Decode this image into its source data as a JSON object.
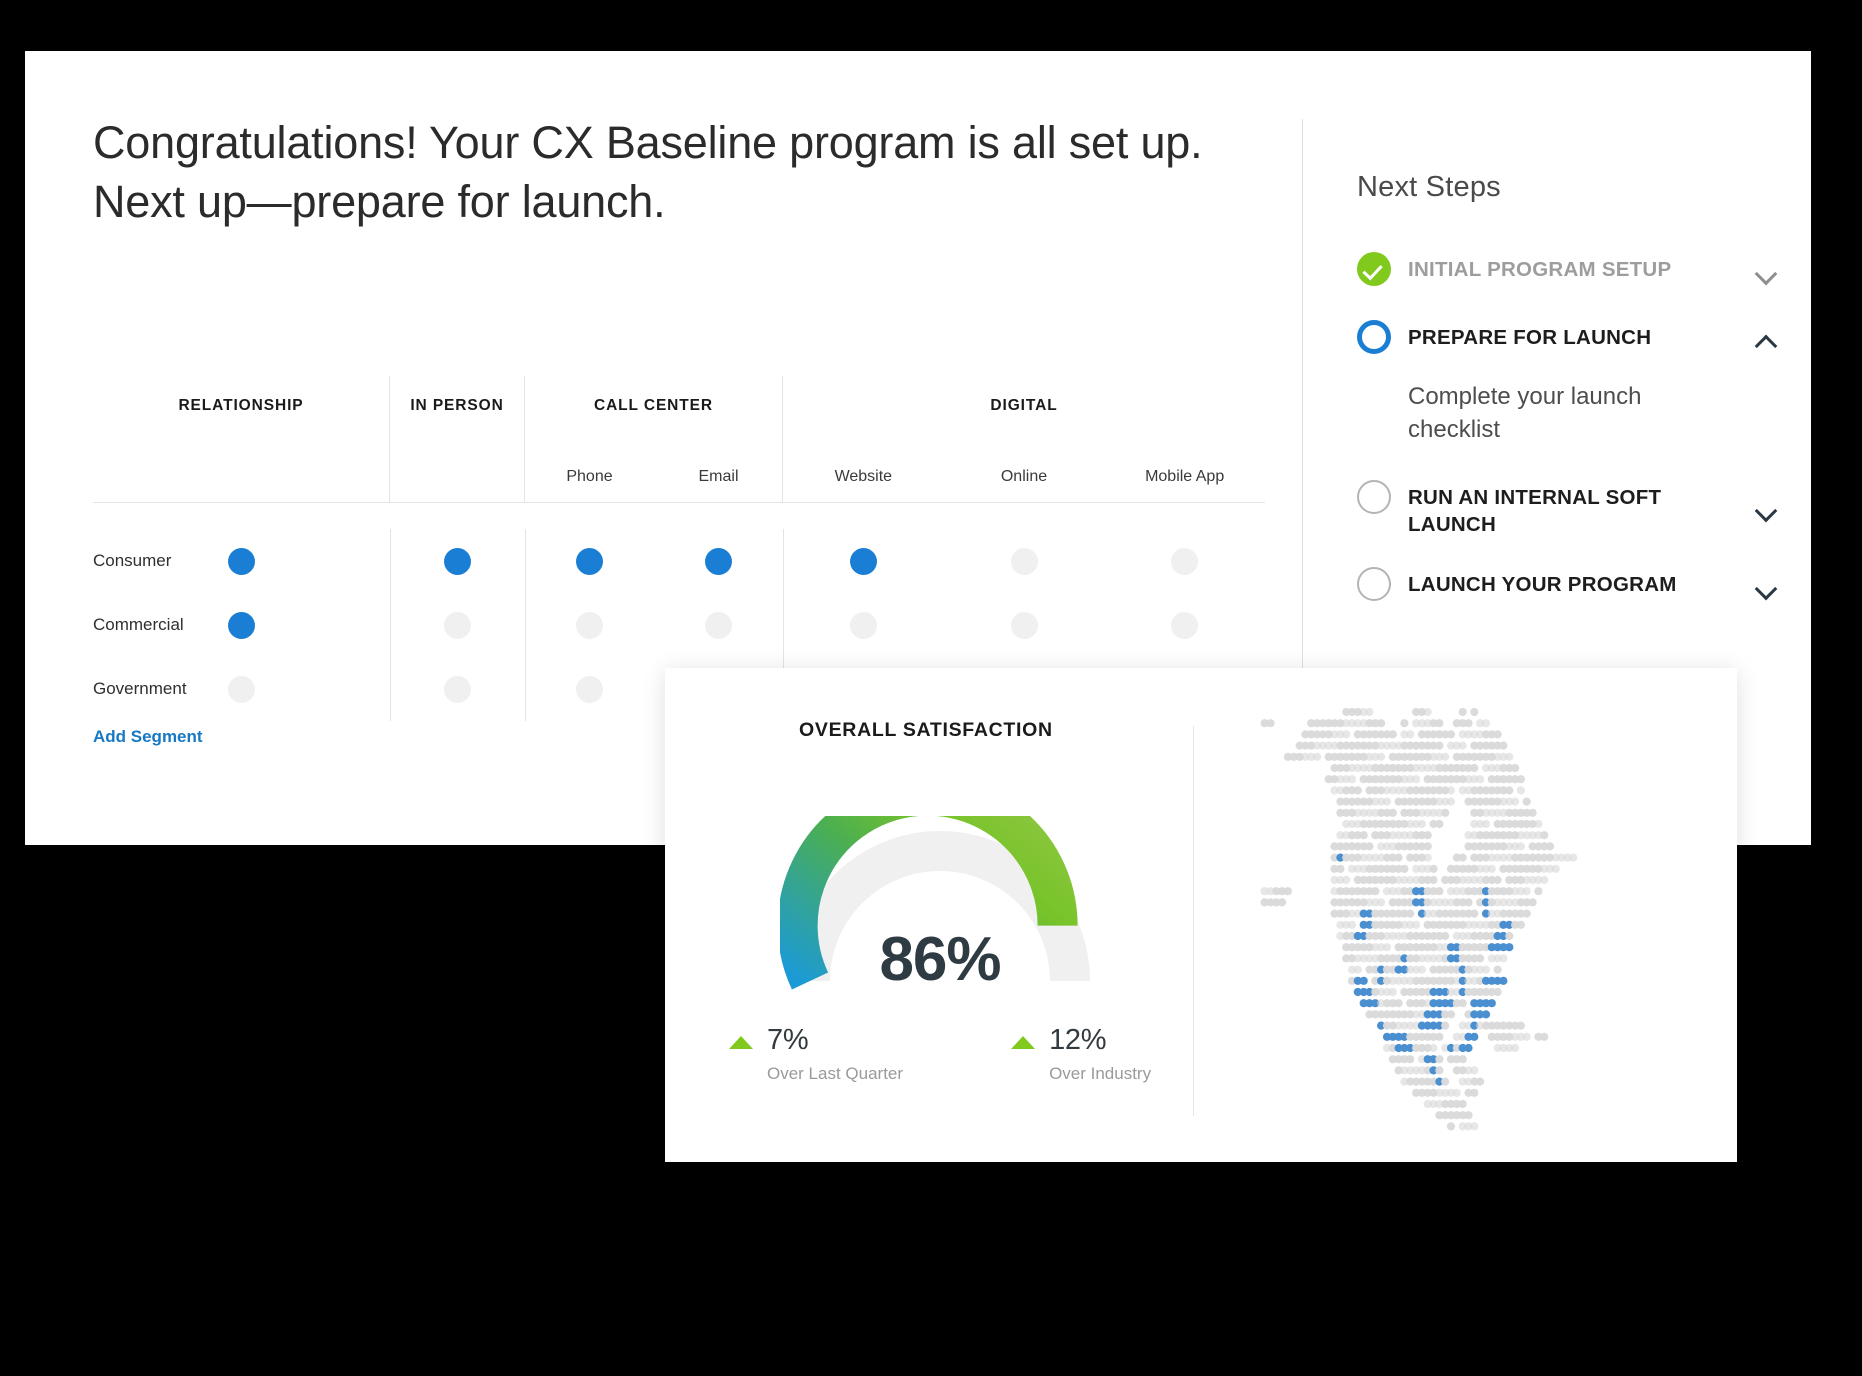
{
  "headline": "Congratulations! Your CX Baseline program is all set up. Next up—prepare for launch.",
  "matrix": {
    "groups": [
      {
        "label": "RELATIONSHIP",
        "subs": [
          ""
        ]
      },
      {
        "label": "IN PERSON",
        "subs": [
          ""
        ]
      },
      {
        "label": "CALL CENTER",
        "subs": [
          "Phone",
          "Email"
        ]
      },
      {
        "label": "DIGITAL",
        "subs": [
          "Website",
          "Online",
          "Mobile App"
        ]
      }
    ],
    "columns": [
      "Relationship",
      "In Person",
      "Phone",
      "Email",
      "Website",
      "Online",
      "Mobile App"
    ],
    "rows": [
      {
        "label": "Consumer",
        "cells": [
          true,
          true,
          true,
          true,
          true,
          false,
          false
        ]
      },
      {
        "label": "Commercial",
        "cells": [
          true,
          false,
          false,
          false,
          false,
          false,
          false
        ]
      },
      {
        "label": "Government",
        "cells": [
          false,
          false,
          false,
          false,
          true,
          false,
          false
        ]
      }
    ],
    "add_segment_label": "Add Segment",
    "dot_on_color": "#1a7fd4",
    "dot_off_color": "#f0f0f0"
  },
  "next_steps": {
    "title": "Next Steps",
    "items": [
      {
        "label": "INITIAL PROGRAM SETUP",
        "state": "done",
        "chevron": "down",
        "muted": true
      },
      {
        "label": "PREPARE FOR LAUNCH",
        "state": "active",
        "chevron": "up",
        "muted": false,
        "sub": "Complete your launch checklist"
      },
      {
        "label": "RUN AN INTERNAL SOFT LAUNCH",
        "state": "todo",
        "chevron": "down",
        "muted": false
      },
      {
        "label": "LAUNCH YOUR PROGRAM",
        "state": "todo",
        "chevron": "down",
        "muted": false
      }
    ],
    "done_color": "#82c91e",
    "active_color": "#1a7fd4"
  },
  "overlay": {
    "title": "OVERALL SATISFACTION",
    "metrics": [
      {
        "value": "7%",
        "caption": "Over Last Quarter",
        "direction": "up"
      },
      {
        "value": "12%",
        "caption": "Over Industry",
        "direction": "up"
      }
    ]
  },
  "chart_data": [
    {
      "type": "pie",
      "subtype": "gauge",
      "title": "OVERALL SATISFACTION",
      "value": 86,
      "unit": "%",
      "display_label": "86%",
      "min": 0,
      "max": 100,
      "start_angle": 180,
      "end_angle": 0,
      "track_color": "#f0f0f0",
      "gradient_stops": [
        "#1c9ad6",
        "#32a39a",
        "#4caf50",
        "#82c91e",
        "#8cc63f"
      ],
      "annotations": [
        {
          "text": "7% Over Last Quarter",
          "value": 7,
          "direction": "up",
          "color": "#82c91e"
        },
        {
          "text": "12% Over Industry",
          "value": 12,
          "direction": "up",
          "color": "#82c91e"
        }
      ],
      "legend": "none",
      "grid": false
    },
    {
      "type": "heatmap",
      "subtype": "dot-density-map",
      "title": "",
      "region": "North America",
      "base_dot_color": "#d9d9d9",
      "highlight_dot_color": "#4a8fd0",
      "legend": "none",
      "grid": false,
      "highlight_count": 78,
      "total_dot_count": 980
    }
  ]
}
